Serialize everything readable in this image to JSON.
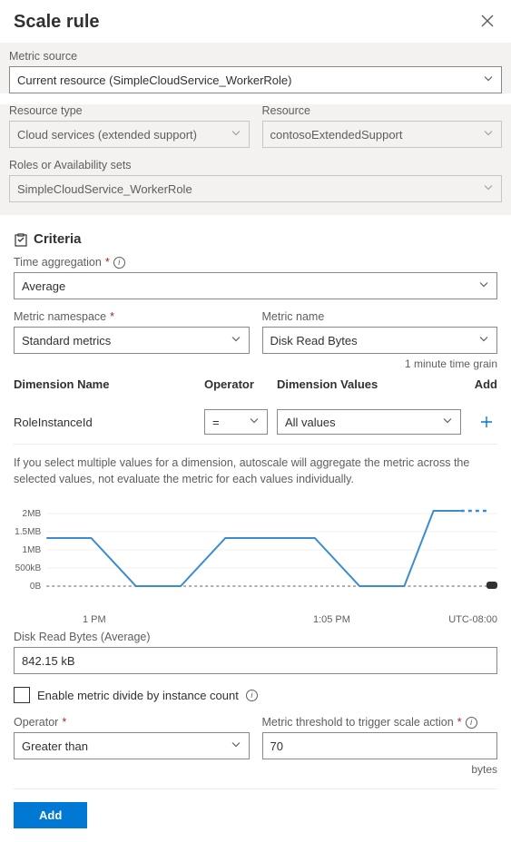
{
  "header": {
    "title": "Scale rule"
  },
  "metricSource": {
    "label": "Metric source",
    "value": "Current resource (SimpleCloudService_WorkerRole)"
  },
  "resourceType": {
    "label": "Resource type",
    "value": "Cloud services (extended support)"
  },
  "resource": {
    "label": "Resource",
    "value": "contosoExtendedSupport"
  },
  "roles": {
    "label": "Roles or Availability sets",
    "value": "SimpleCloudService_WorkerRole"
  },
  "criteria": {
    "title": "Criteria",
    "timeAgg": {
      "label": "Time aggregation",
      "value": "Average"
    },
    "metricNamespace": {
      "label": "Metric namespace",
      "value": "Standard metrics"
    },
    "metricName": {
      "label": "Metric name",
      "value": "Disk Read Bytes"
    },
    "timeGrain": "1 minute time grain",
    "dimHead": {
      "name": "Dimension Name",
      "op": "Operator",
      "vals": "Dimension Values",
      "add": "Add"
    },
    "dimRow": {
      "name": "RoleInstanceId",
      "op": "=",
      "vals": "All values"
    },
    "help": "If you select multiple values for a dimension, autoscale will aggregate the metric across the selected values, not evaluate the metric for each values individually.",
    "metricDisplay": {
      "label": "Disk Read Bytes (Average)",
      "value": "842.15 kB"
    },
    "divideCheck": "Enable metric divide by instance count",
    "operator": {
      "label": "Operator",
      "value": "Greater than"
    },
    "threshold": {
      "label": "Metric threshold to trigger scale action",
      "value": "70",
      "unit": "bytes"
    }
  },
  "chart_data": {
    "type": "line",
    "title": "",
    "xlabel": "",
    "ylabel": "",
    "y_ticks": [
      "0B",
      "500kB",
      "1MB",
      "1.5MB",
      "2MB"
    ],
    "x_ticks": [
      "1 PM",
      "1:05 PM"
    ],
    "tz": "UTC-08:00",
    "ylim": [
      0,
      2200000
    ],
    "series": [
      {
        "name": "Disk Read Bytes",
        "x": [
          0,
          1,
          2,
          3,
          4,
          5,
          6,
          7,
          8,
          9,
          10
        ],
        "values": [
          1400000,
          1400000,
          0,
          0,
          1400000,
          1400000,
          1400000,
          0,
          0,
          2100000,
          2100000
        ]
      }
    ]
  },
  "footer": {
    "add": "Add"
  }
}
